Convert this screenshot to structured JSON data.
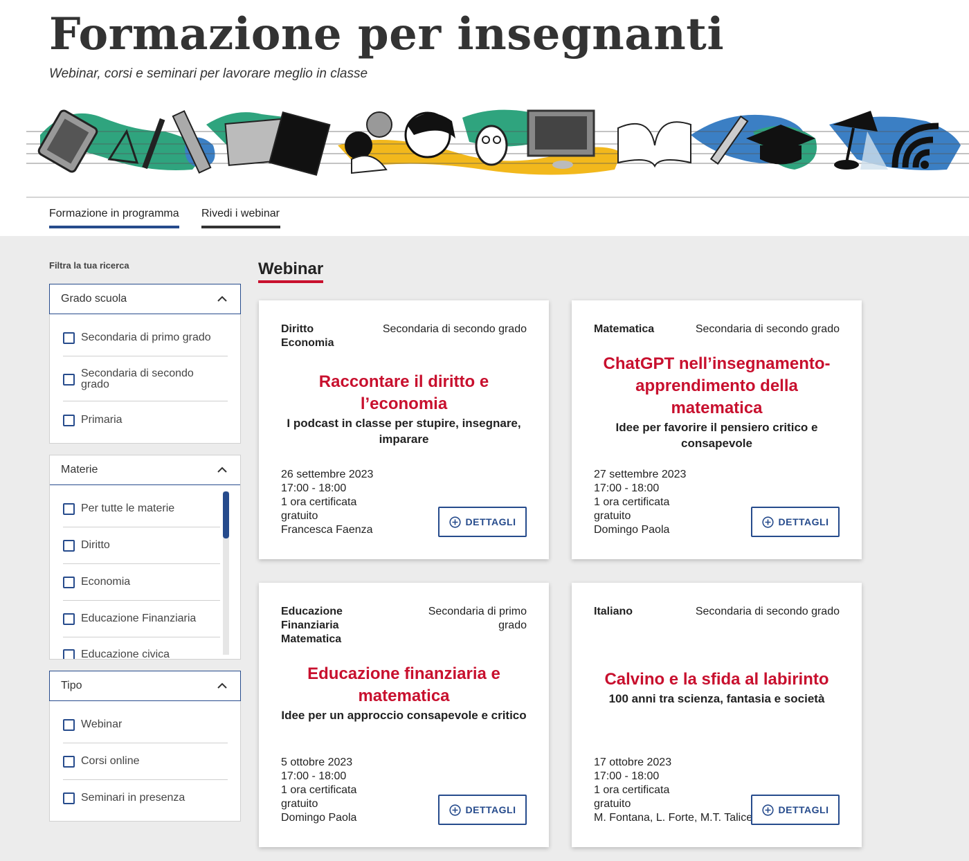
{
  "header": {
    "title": "Formazione per insegnanti",
    "subtitle": "Webinar, corsi e seminari per lavorare meglio in classe"
  },
  "tabs": [
    {
      "label": "Formazione in programma",
      "active": true
    },
    {
      "label": "Rivedi i webinar",
      "active": false
    }
  ],
  "filters": {
    "label": "Filtra la tua ricerca",
    "groups": [
      {
        "title": "Grado scuola",
        "items": [
          "Secondaria di primo grado",
          "Secondaria di secondo grado",
          "Primaria"
        ]
      },
      {
        "title": "Materie",
        "items": [
          "Per tutte le materie",
          "Diritto",
          "Economia",
          "Educazione Finanziaria",
          "Educazione civica"
        ]
      },
      {
        "title": "Tipo",
        "items": [
          "Webinar",
          "Corsi online",
          "Seminari in presenza"
        ]
      }
    ]
  },
  "section": {
    "title": "Webinar"
  },
  "cards": [
    {
      "subject": [
        "Diritto",
        "Economia"
      ],
      "grade": "Secondaria di secondo grado",
      "title": "Raccontare il diritto e l’economia",
      "subtitle": "I podcast in classe per stupire, insegnare, imparare",
      "date": "26 settembre 2023",
      "time": "17:00 - 18:00",
      "hours": "1 ora certificata",
      "price": "gratuito",
      "speaker": "Francesca Faenza",
      "button": "DETTAGLI"
    },
    {
      "subject": [
        "Matematica"
      ],
      "grade": "Secondaria di secondo grado",
      "title": "ChatGPT nell’insegnamento-apprendimento della matematica",
      "subtitle": "Idee per favorire il pensiero critico e consapevole",
      "date": "27 settembre 2023",
      "time": "17:00 - 18:00",
      "hours": "1 ora certificata",
      "price": "gratuito",
      "speaker": "Domingo Paola",
      "button": "DETTAGLI"
    },
    {
      "subject": [
        "Educazione",
        "Finanziaria",
        "Matematica"
      ],
      "grade": "Secondaria di primo grado",
      "title": "Educazione finanziaria e matematica",
      "subtitle": "Idee per un approccio consapevole e critico",
      "date": "5 ottobre 2023",
      "time": "17:00 - 18:00",
      "hours": "1 ora certificata",
      "price": "gratuito",
      "speaker": "Domingo Paola",
      "button": "DETTAGLI"
    },
    {
      "subject": [
        "Italiano"
      ],
      "grade": "Secondaria di secondo grado",
      "title": "Calvino e la sfida al labirinto",
      "subtitle": "100 anni tra scienza, fantasia e società",
      "date": "17 ottobre 2023",
      "time": "17:00 - 18:00",
      "hours": "1 ora certificata",
      "price": "gratuito",
      "speaker": "M. Fontana, L. Forte, M.T. Talice",
      "button": "DETTAGLI"
    }
  ],
  "colors": {
    "accent": "#264b8c",
    "brand_red": "#c8102e",
    "banner_green": "#2fa47e",
    "banner_yellow": "#f2b81c",
    "banner_blue": "#3b7fc4"
  },
  "icons": {
    "chevron": "chevron-up-icon",
    "details": "plus-circle-icon",
    "checkbox": "checkbox-icon"
  }
}
